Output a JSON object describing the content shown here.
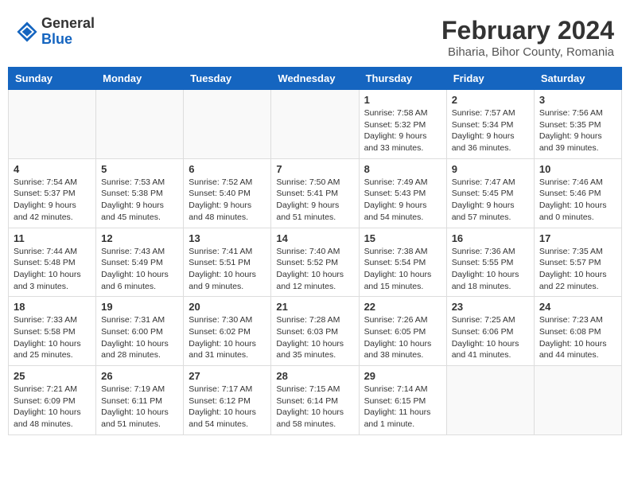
{
  "header": {
    "logo_general": "General",
    "logo_blue": "Blue",
    "month_title": "February 2024",
    "location": "Biharia, Bihor County, Romania"
  },
  "calendar": {
    "days_of_week": [
      "Sunday",
      "Monday",
      "Tuesday",
      "Wednesday",
      "Thursday",
      "Friday",
      "Saturday"
    ],
    "weeks": [
      {
        "days": [
          {
            "number": "",
            "info": ""
          },
          {
            "number": "",
            "info": ""
          },
          {
            "number": "",
            "info": ""
          },
          {
            "number": "",
            "info": ""
          },
          {
            "number": "1",
            "info": "Sunrise: 7:58 AM\nSunset: 5:32 PM\nDaylight: 9 hours\nand 33 minutes."
          },
          {
            "number": "2",
            "info": "Sunrise: 7:57 AM\nSunset: 5:34 PM\nDaylight: 9 hours\nand 36 minutes."
          },
          {
            "number": "3",
            "info": "Sunrise: 7:56 AM\nSunset: 5:35 PM\nDaylight: 9 hours\nand 39 minutes."
          }
        ]
      },
      {
        "days": [
          {
            "number": "4",
            "info": "Sunrise: 7:54 AM\nSunset: 5:37 PM\nDaylight: 9 hours\nand 42 minutes."
          },
          {
            "number": "5",
            "info": "Sunrise: 7:53 AM\nSunset: 5:38 PM\nDaylight: 9 hours\nand 45 minutes."
          },
          {
            "number": "6",
            "info": "Sunrise: 7:52 AM\nSunset: 5:40 PM\nDaylight: 9 hours\nand 48 minutes."
          },
          {
            "number": "7",
            "info": "Sunrise: 7:50 AM\nSunset: 5:41 PM\nDaylight: 9 hours\nand 51 minutes."
          },
          {
            "number": "8",
            "info": "Sunrise: 7:49 AM\nSunset: 5:43 PM\nDaylight: 9 hours\nand 54 minutes."
          },
          {
            "number": "9",
            "info": "Sunrise: 7:47 AM\nSunset: 5:45 PM\nDaylight: 9 hours\nand 57 minutes."
          },
          {
            "number": "10",
            "info": "Sunrise: 7:46 AM\nSunset: 5:46 PM\nDaylight: 10 hours\nand 0 minutes."
          }
        ]
      },
      {
        "days": [
          {
            "number": "11",
            "info": "Sunrise: 7:44 AM\nSunset: 5:48 PM\nDaylight: 10 hours\nand 3 minutes."
          },
          {
            "number": "12",
            "info": "Sunrise: 7:43 AM\nSunset: 5:49 PM\nDaylight: 10 hours\nand 6 minutes."
          },
          {
            "number": "13",
            "info": "Sunrise: 7:41 AM\nSunset: 5:51 PM\nDaylight: 10 hours\nand 9 minutes."
          },
          {
            "number": "14",
            "info": "Sunrise: 7:40 AM\nSunset: 5:52 PM\nDaylight: 10 hours\nand 12 minutes."
          },
          {
            "number": "15",
            "info": "Sunrise: 7:38 AM\nSunset: 5:54 PM\nDaylight: 10 hours\nand 15 minutes."
          },
          {
            "number": "16",
            "info": "Sunrise: 7:36 AM\nSunset: 5:55 PM\nDaylight: 10 hours\nand 18 minutes."
          },
          {
            "number": "17",
            "info": "Sunrise: 7:35 AM\nSunset: 5:57 PM\nDaylight: 10 hours\nand 22 minutes."
          }
        ]
      },
      {
        "days": [
          {
            "number": "18",
            "info": "Sunrise: 7:33 AM\nSunset: 5:58 PM\nDaylight: 10 hours\nand 25 minutes."
          },
          {
            "number": "19",
            "info": "Sunrise: 7:31 AM\nSunset: 6:00 PM\nDaylight: 10 hours\nand 28 minutes."
          },
          {
            "number": "20",
            "info": "Sunrise: 7:30 AM\nSunset: 6:02 PM\nDaylight: 10 hours\nand 31 minutes."
          },
          {
            "number": "21",
            "info": "Sunrise: 7:28 AM\nSunset: 6:03 PM\nDaylight: 10 hours\nand 35 minutes."
          },
          {
            "number": "22",
            "info": "Sunrise: 7:26 AM\nSunset: 6:05 PM\nDaylight: 10 hours\nand 38 minutes."
          },
          {
            "number": "23",
            "info": "Sunrise: 7:25 AM\nSunset: 6:06 PM\nDaylight: 10 hours\nand 41 minutes."
          },
          {
            "number": "24",
            "info": "Sunrise: 7:23 AM\nSunset: 6:08 PM\nDaylight: 10 hours\nand 44 minutes."
          }
        ]
      },
      {
        "days": [
          {
            "number": "25",
            "info": "Sunrise: 7:21 AM\nSunset: 6:09 PM\nDaylight: 10 hours\nand 48 minutes."
          },
          {
            "number": "26",
            "info": "Sunrise: 7:19 AM\nSunset: 6:11 PM\nDaylight: 10 hours\nand 51 minutes."
          },
          {
            "number": "27",
            "info": "Sunrise: 7:17 AM\nSunset: 6:12 PM\nDaylight: 10 hours\nand 54 minutes."
          },
          {
            "number": "28",
            "info": "Sunrise: 7:15 AM\nSunset: 6:14 PM\nDaylight: 10 hours\nand 58 minutes."
          },
          {
            "number": "29",
            "info": "Sunrise: 7:14 AM\nSunset: 6:15 PM\nDaylight: 11 hours\nand 1 minute."
          },
          {
            "number": "",
            "info": ""
          },
          {
            "number": "",
            "info": ""
          }
        ]
      }
    ]
  }
}
